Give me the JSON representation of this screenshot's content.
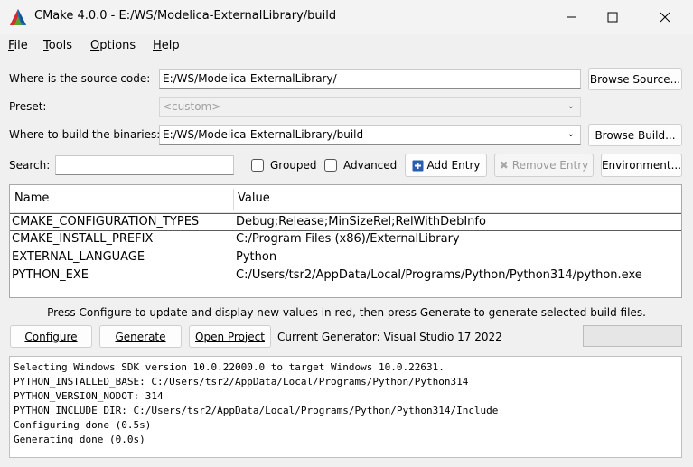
{
  "window": {
    "title": "CMake 4.0.0 - E:/WS/Modelica-ExternalLibrary/build"
  },
  "menu": [
    {
      "ul": "F",
      "rest": "ile"
    },
    {
      "ul": "T",
      "rest": "ools"
    },
    {
      "ul": "O",
      "rest": "ptions"
    },
    {
      "ul": "H",
      "rest": "elp"
    }
  ],
  "source": {
    "label": "Where is the source code:",
    "value": "E:/WS/Modelica-ExternalLibrary/",
    "browse": "Browse Source..."
  },
  "preset": {
    "label": "Preset:",
    "value": "<custom>"
  },
  "build": {
    "label": "Where to build the binaries:",
    "value": "E:/WS/Modelica-ExternalLibrary/build",
    "browse": "Browse Build..."
  },
  "search": {
    "label": "Search:",
    "value": ""
  },
  "options": {
    "grouped": "Grouped",
    "advanced": "Advanced",
    "add_entry": "Add Entry",
    "remove_entry": "Remove Entry",
    "environment": "Environment..."
  },
  "table": {
    "headers": [
      "Name",
      "Value"
    ],
    "rows": [
      {
        "name": "CMAKE_CONFIGURATION_TYPES",
        "value": "Debug;Release;MinSizeRel;RelWithDebInfo"
      },
      {
        "name": "CMAKE_INSTALL_PREFIX",
        "value": "C:/Program Files (x86)/ExternalLibrary"
      },
      {
        "name": "EXTERNAL_LANGUAGE",
        "value": "Python"
      },
      {
        "name": "PYTHON_EXE",
        "value": "C:/Users/tsr2/AppData/Local/Programs/Python/Python314/python.exe"
      }
    ]
  },
  "hint": "Press Configure to update and display new values in red, then press Generate to generate selected build files.",
  "actions": {
    "configure": "Configure",
    "generate": "Generate",
    "open_project": "Open Project",
    "generator": "Current Generator: Visual Studio 17 2022"
  },
  "progress": 0,
  "log": [
    "Selecting Windows SDK version 10.0.22000.0 to target Windows 10.0.22631.",
    "PYTHON_INSTALLED_BASE: C:/Users/tsr2/AppData/Local/Programs/Python/Python314",
    "PYTHON_VERSION_NODOT: 314",
    "PYTHON_INCLUDE_DIR: C:/Users/tsr2/AppData/Local/Programs/Python/Python314/Include",
    "Configuring done (0.5s)",
    "Generating done (0.0s)"
  ]
}
